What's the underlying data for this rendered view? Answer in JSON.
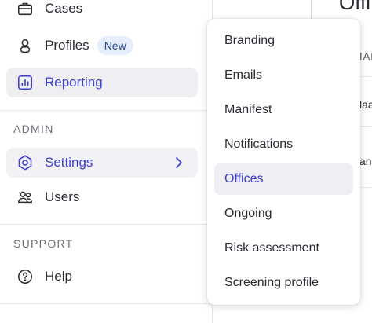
{
  "sidebar": {
    "items": [
      {
        "label": "Cases",
        "icon": "briefcase-icon"
      },
      {
        "label": "Profiles",
        "icon": "person-icon",
        "badge": "New"
      },
      {
        "label": "Reporting",
        "icon": "chart-icon"
      }
    ],
    "admin": {
      "heading": "ADMIN",
      "items": [
        {
          "label": "Settings",
          "icon": "gear-icon"
        },
        {
          "label": "Users",
          "icon": "users-icon"
        }
      ]
    },
    "support": {
      "heading": "SUPPORT",
      "items": [
        {
          "label": "Help",
          "icon": "question-icon"
        }
      ]
    }
  },
  "main": {
    "title_fragment": "Offi",
    "col_fragment": "IAN",
    "row_fragments": [
      "laa",
      "an"
    ]
  },
  "settings_menu": {
    "items": [
      "Branding",
      "Emails",
      "Manifest",
      "Notifications",
      "Offices",
      "Ongoing",
      "Risk assessment",
      "Screening profile"
    ],
    "selected": "Offices"
  },
  "colors": {
    "accent": "#3d3fcf",
    "active_bg": "#efeff3",
    "badge_bg": "#e7eefb"
  }
}
